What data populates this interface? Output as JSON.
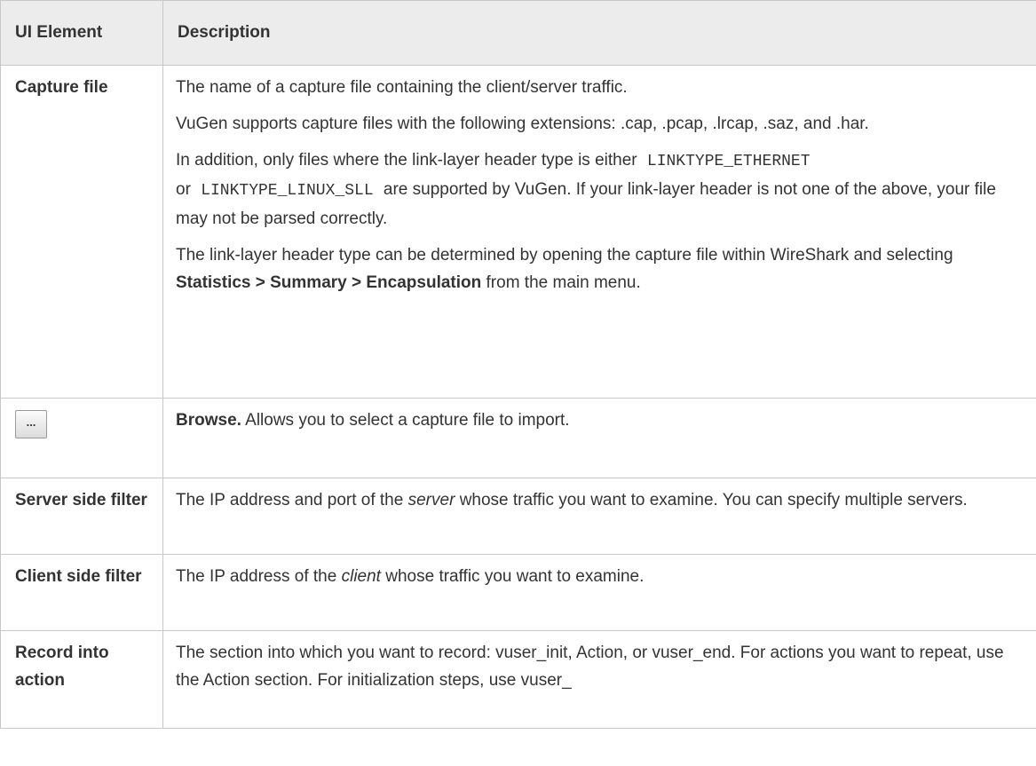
{
  "table": {
    "headers": {
      "ui_element": "UI Element",
      "description": "Description"
    },
    "capture_file": {
      "name": "Capture file",
      "p1": "The name of a capture file containing the client/server traffic.",
      "p2": "VuGen supports capture files with the following extensions: .cap, .pcap, .lrcap, .saz, and .har.",
      "p3_a": "In addition, only files where the link-layer header type is either",
      "p3_code1": "LINKTYPE_ETHERNET",
      "p3_b": "or",
      "p3_code2": "LINKTYPE_LINUX_SLL",
      "p3_c": "are supported by VuGen. If your link-layer header is not one of the above, your file may not be parsed correctly.",
      "p4_a": "The link-layer header type can be determined by opening the capture file within WireShark and selecting",
      "p4_bold": "Statistics > Summary > Encapsulation",
      "p4_b": "from the main menu."
    },
    "browse": {
      "button_label": "...",
      "bold": "Browse.",
      "text": "Allows you to select a capture file to import."
    },
    "server_filter": {
      "name": "Server side filter",
      "a": "The IP address and port of the",
      "italic": "server",
      "b": "whose traffic you want to examine. You can specify multiple servers."
    },
    "client_filter": {
      "name": "Client side filter",
      "a": "The IP address of the",
      "italic": "client",
      "b": "whose traffic you want to examine."
    },
    "record_into_action": {
      "name": "Record into action",
      "text": "The section into which you want to record: vuser_init, Action, or vuser_end. For actions you want to repeat, use the Action section. For initialization steps, use vuser_"
    }
  }
}
